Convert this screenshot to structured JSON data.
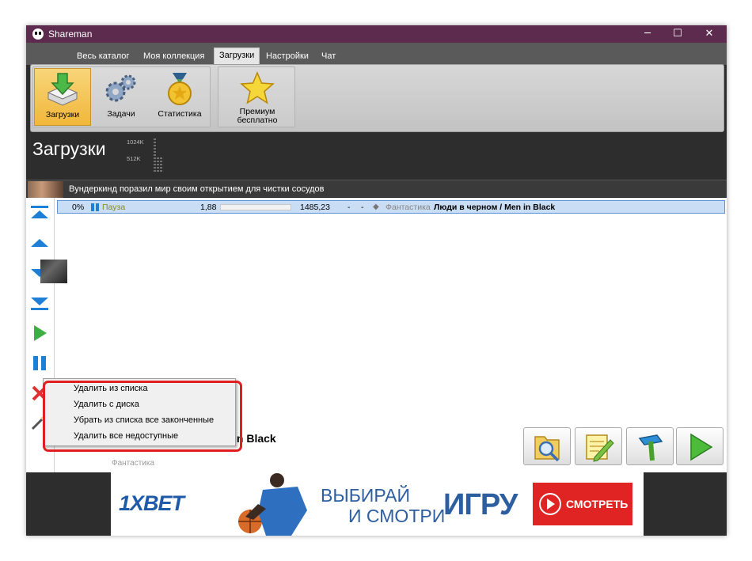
{
  "window": {
    "title": "Shareman",
    "minimize_glyph": "─",
    "maximize_glyph": "☐",
    "close_glyph": "✕"
  },
  "menu": {
    "tabs": [
      {
        "label": "Весь каталог"
      },
      {
        "label": "Моя коллекция"
      },
      {
        "label": "Загрузки"
      },
      {
        "label": "Настройки"
      },
      {
        "label": "Чат"
      }
    ],
    "active_tab": "Загрузки"
  },
  "ribbon": {
    "buttons": [
      {
        "label": "Загрузки",
        "icon": "download-tray-icon"
      },
      {
        "label": "Задачи",
        "icon": "gears-icon"
      },
      {
        "label": "Статистика",
        "icon": "medal-icon"
      }
    ],
    "premium": {
      "line1": "Премиум",
      "line2": "бесплатно",
      "icon": "star-icon"
    }
  },
  "page": {
    "title": "Загрузки",
    "speed_label_high": "1024K",
    "speed_label_low": "512K"
  },
  "news": {
    "text": "Вундеркинд поразил мир своим открытием для чистки сосудов"
  },
  "download": {
    "percent": "0%",
    "status": "Пауза",
    "downloaded": "1,88",
    "progress": 0,
    "size": "1485,23",
    "speed": "-",
    "time": "-",
    "genre": "Фантастика",
    "title": "Люди в черном / Men in Black"
  },
  "selected_movie": {
    "title_visible": "in Black",
    "genre_visible": "Фантастика"
  },
  "context_menu": {
    "items": [
      {
        "label": "Удалить из списка"
      },
      {
        "label": "Удалить с диска"
      },
      {
        "label": "Убрать из списка все законченные"
      },
      {
        "label": "Удалить все недоступные"
      }
    ]
  },
  "ad": {
    "brand": "1XBET",
    "line1": "ВЫБИРАЙ",
    "line2": "И СМОТРИ",
    "line3": "ИГРУ",
    "cta": "СМОТРЕТЬ"
  },
  "colors": {
    "titlebar": "#5c2b4e",
    "highlight": "#e02020",
    "selected_row": "#c9ddf5",
    "ribbon_selected": "#f1b73a"
  }
}
